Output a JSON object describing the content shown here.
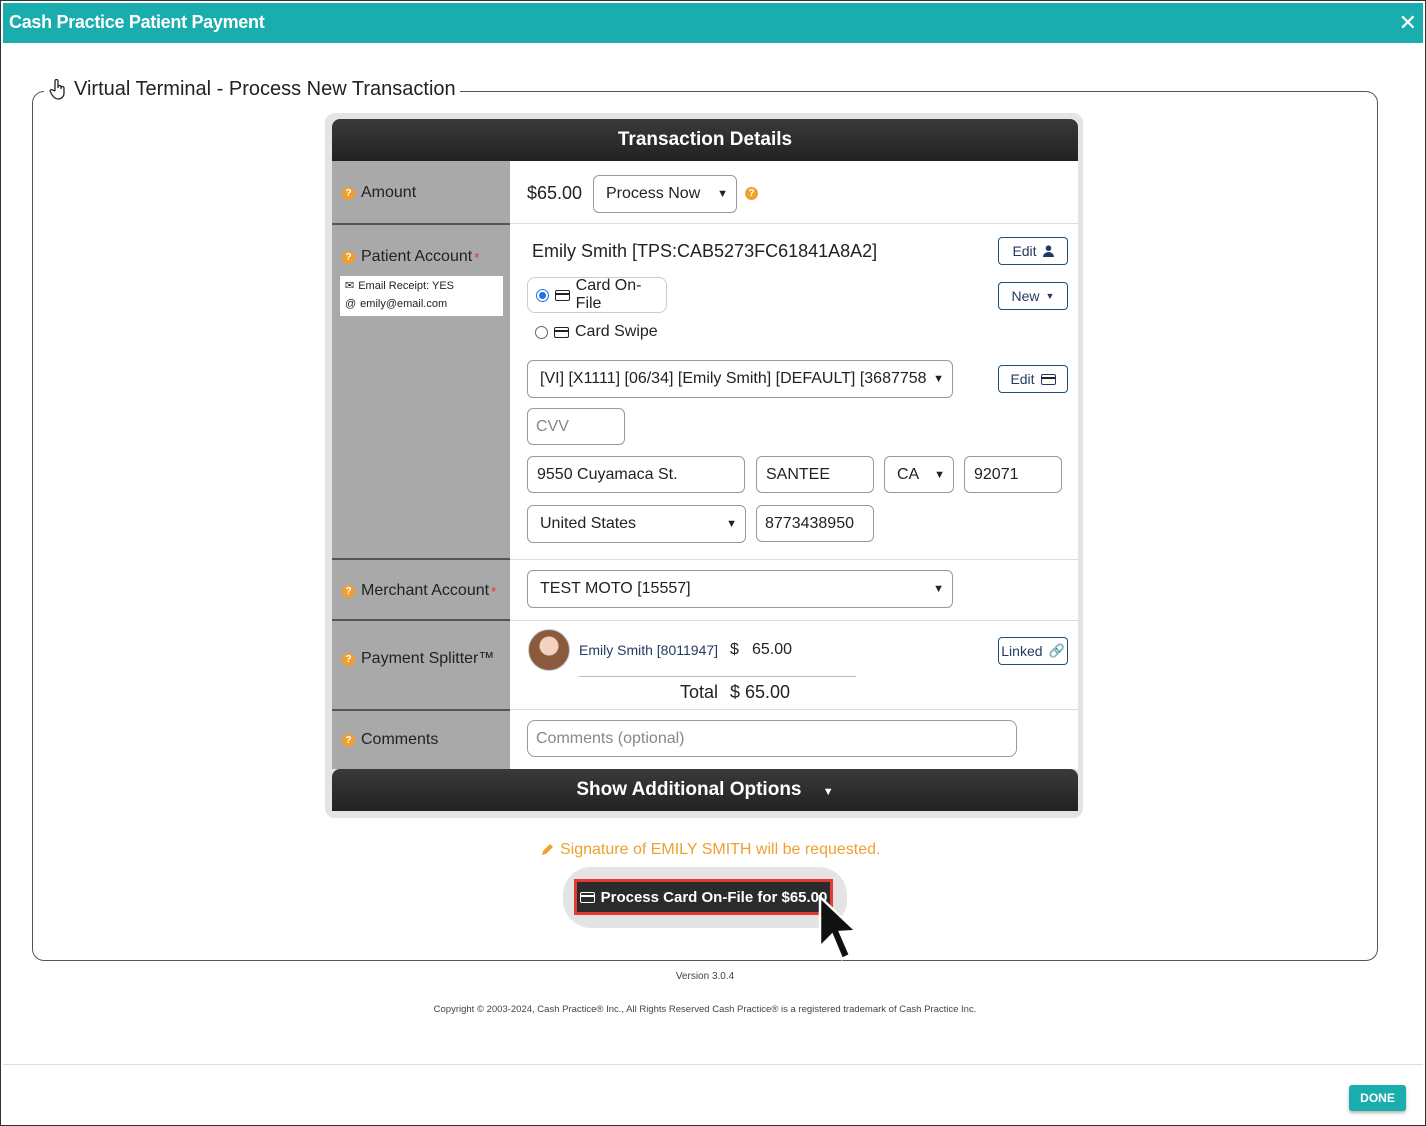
{
  "window": {
    "title": "Cash Practice Patient Payment",
    "close_glyph": "✕"
  },
  "legend": {
    "title": "Virtual Terminal - Process New Transaction"
  },
  "transaction": {
    "header": "Transaction Details",
    "amount": {
      "label": "Amount",
      "value": "$65.00",
      "timing_selected": "Process Now"
    },
    "patient": {
      "label": "Patient Account",
      "required": "*",
      "email_receipt": "Email Receipt: YES",
      "email": "emily@email.com",
      "name": "Emily Smith [TPS:CAB5273FC61841A8A2]",
      "edit_label": "Edit",
      "new_label": "New",
      "option_card_on_file": "Card On-File",
      "option_card_swipe": "Card Swipe",
      "card_selected": "[VI] [X1111] [06/34] [Emily Smith] [DEFAULT] [3687758",
      "card_edit_label": "Edit",
      "cvv_placeholder": "CVV",
      "street": "9550 Cuyamaca St.",
      "city": "SANTEE",
      "state": "CA",
      "zip": "92071",
      "country": "United States",
      "phone": "8773438950"
    },
    "merchant": {
      "label": "Merchant Account",
      "required": "*",
      "selected": "TEST MOTO [15557]"
    },
    "splitter": {
      "label": "Payment Splitter™",
      "person": "Emily Smith [8011947]",
      "currency": "$",
      "amount": "65.00",
      "linked_label": "Linked",
      "total_label": "Total",
      "total_value": "$ 65.00"
    },
    "comments": {
      "label": "Comments",
      "placeholder": "Comments (optional)"
    },
    "more_options": "Show Additional Options"
  },
  "signature_notice": "Signature of EMILY SMITH will be requested.",
  "process_button": "Process Card On-File for $65.00",
  "version": "Version 3.0.4",
  "copyright": "Copyright © 2003-2024, Cash Practice® Inc., All Rights Reserved Cash Practice® is a registered trademark of Cash Practice Inc.",
  "done_button": "DONE",
  "colors": {
    "teal": "#1aadad",
    "label_bg": "#aaa9a9",
    "help": "#f0a030",
    "highlight": "#e53935"
  }
}
